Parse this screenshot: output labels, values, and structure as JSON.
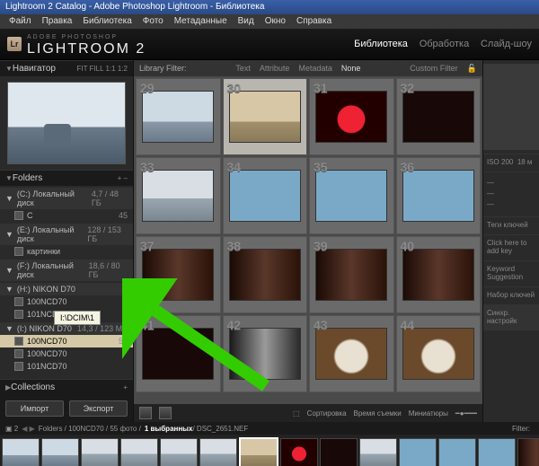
{
  "window_title": "Lightroom 2 Catalog - Adobe Photoshop Lightroom - Библиотека",
  "menu": [
    "Файл",
    "Правка",
    "Библиотека",
    "Фото",
    "Метаданные",
    "Вид",
    "Окно",
    "Справка"
  ],
  "brand": {
    "small": "ADOBE PHOTOSHOP",
    "name": "LIGHTROOM 2"
  },
  "modules": [
    {
      "label": "Библиотека",
      "active": true
    },
    {
      "label": "Обработка",
      "active": false
    },
    {
      "label": "Слайд-шоу",
      "active": false
    }
  ],
  "navigator": {
    "title": "Навигатор",
    "fit": "FIT",
    "fill": "FILL",
    "r1": "1:1",
    "r2": "1:2"
  },
  "folders": {
    "title": "Folders",
    "disks": [
      {
        "tri": "▼",
        "name": "(C:) Локальный диск",
        "cap": "4,7 / 48 ГБ",
        "subs": [
          {
            "name": "C",
            "cnt": "45"
          }
        ]
      },
      {
        "tri": "▼",
        "name": "(E:) Локальный диск",
        "cap": "128 / 153 ГБ",
        "subs": [
          {
            "name": "картинки",
            "cnt": ""
          }
        ]
      },
      {
        "tri": "▼",
        "name": "(F:) Локальный диск",
        "cap": "18,6 / 80 ГБ",
        "subs": []
      },
      {
        "tri": "▼",
        "name": "(H:) NIKON D70",
        "cap": "",
        "subs": [
          {
            "name": "100NCD70",
            "cnt": ""
          },
          {
            "name": "101NCD70",
            "cnt": ""
          }
        ]
      },
      {
        "tri": "▼",
        "name": "(I:) NIKON D70",
        "cap": "14,3 / 123 МБ",
        "subs": [
          {
            "name": "100NCD70",
            "cnt": "55",
            "sel": true
          },
          {
            "name": "100NCD70",
            "cnt": ""
          },
          {
            "name": "101NCD70",
            "cnt": ""
          }
        ]
      }
    ]
  },
  "tooltip": "I:\\DCIM\\1",
  "collections": {
    "title": "Collections"
  },
  "import": "Импорт",
  "export": "Экспорт",
  "library_filter": {
    "label": "Library Filter:",
    "tabs": [
      "Text",
      "Attribute",
      "Metadata",
      "None"
    ],
    "custom": "Custom Filter"
  },
  "cells": [
    {
      "n": "29",
      "cls": "sky"
    },
    {
      "n": "30",
      "cls": "sepia",
      "sel": true
    },
    {
      "n": "31",
      "cls": "red"
    },
    {
      "n": "32",
      "cls": "dark"
    },
    {
      "n": "33",
      "cls": "snow"
    },
    {
      "n": "34",
      "cls": "blue"
    },
    {
      "n": "35",
      "cls": "blue"
    },
    {
      "n": "36",
      "cls": "blue"
    },
    {
      "n": "37",
      "cls": "rat"
    },
    {
      "n": "38",
      "cls": "rat"
    },
    {
      "n": "39",
      "cls": "rat"
    },
    {
      "n": "40",
      "cls": "rat"
    },
    {
      "n": "41",
      "cls": "dark"
    },
    {
      "n": "42",
      "cls": "rat2"
    },
    {
      "n": "43",
      "cls": "wrat"
    },
    {
      "n": "44",
      "cls": "wrat"
    }
  ],
  "toolbar": {
    "sort": "Сортировка",
    "sort_val": "Время съемки",
    "thumbs": "Миниатюры"
  },
  "right": {
    "iso": "ISO 200",
    "mm": "18 м",
    "tags": "Теги ключей",
    "hint": "Click here to add key",
    "sugg": "Keyword Suggestion",
    "set": "Набор ключей",
    "sync": "Синхр. настройк"
  },
  "status": {
    "path": "Folders / 100NCD70 / 55 фото /",
    "sel": "1 выбранных",
    "file": "/ DSC_2651.NEF",
    "filter": "Filter:"
  },
  "film": [
    "sky",
    "sky",
    "snow",
    "snow",
    "snow",
    "snow",
    "sepia",
    "red",
    "dark",
    "snow",
    "blue",
    "blue",
    "blue",
    "rat"
  ]
}
